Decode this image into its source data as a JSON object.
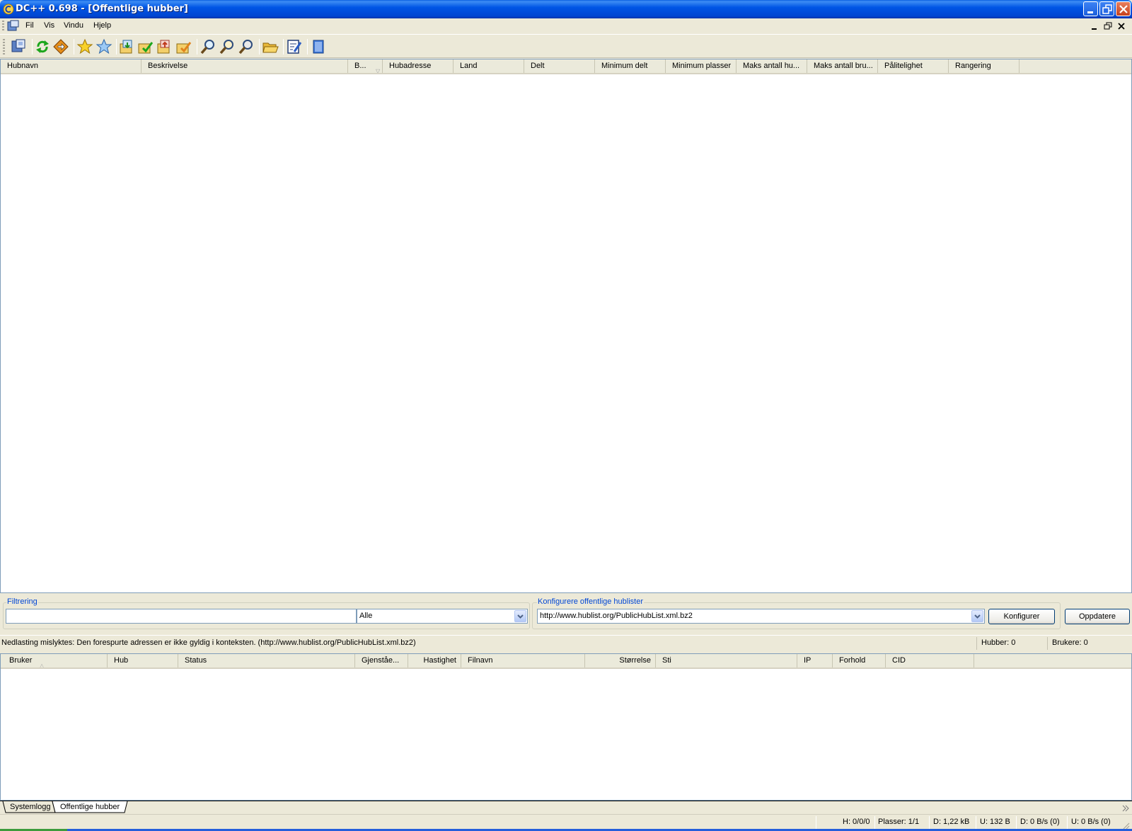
{
  "window": {
    "title": "DC++ 0.698 - [Offentlige hubber]"
  },
  "menu": {
    "items": [
      "Fil",
      "Vis",
      "Vindu",
      "Hjelp"
    ]
  },
  "toolbar": {
    "icons": [
      "connect-icon",
      "reconnect-icon",
      "follow-redirect-icon",
      "favorite-hubs-icon",
      "favorite-users-icon",
      "download-queue-icon",
      "finished-downloads-icon",
      "upload-queue-icon",
      "finished-uploads-icon",
      "search-icon",
      "adl-search-icon",
      "search-spy-icon",
      "open-filelist-icon",
      "settings-icon",
      "notepad-icon"
    ]
  },
  "hub_list": {
    "columns": [
      "Hubnavn",
      "Beskrivelse",
      "B...",
      "Hubadresse",
      "Land",
      "Delt",
      "Minimum delt",
      "Minimum plasser",
      "Maks antall hu...",
      "Maks antall bru...",
      "Pålitelighet",
      "Rangering"
    ],
    "rows": []
  },
  "filter": {
    "group_label": "Filtrering",
    "text_value": "",
    "column_selected": "Alle"
  },
  "hublists": {
    "group_label": "Konfigurere offentlige hublister",
    "selected_url": "http://www.hublist.org/PublicHubList.xml.bz2",
    "configure_label": "Konfigurer",
    "refresh_label": "Oppdatere"
  },
  "status": {
    "message": "Nedlasting mislyktes: Den forespurte adressen er ikke gyldig i konteksten. (http://www.hublist.org/PublicHubList.xml.bz2)",
    "hubs": "Hubber: 0",
    "users": "Brukere: 0"
  },
  "transfer_list": {
    "columns": [
      "Bruker",
      "Hub",
      "Status",
      "Gjenståe...",
      "Hastighet",
      "Filnavn",
      "Størrelse",
      "Sti",
      "IP",
      "Forhold",
      "CID"
    ],
    "rows": []
  },
  "tabs": [
    "Systemlogg",
    "Offentlige hubber"
  ],
  "statusbar": {
    "hubs": "H: 0/0/0",
    "slots": "Plasser: 1/1",
    "downloaded": "D: 1,22 kB",
    "uploaded": "U: 132 B",
    "download_rate": "D: 0 B/s (0)",
    "upload_rate": "U: 0 B/s (0)"
  },
  "colors": {
    "titlebar": "#0055e5",
    "group_label": "#0046d5",
    "list_border": "#7f9db9",
    "window_bg": "#ece9d8"
  }
}
